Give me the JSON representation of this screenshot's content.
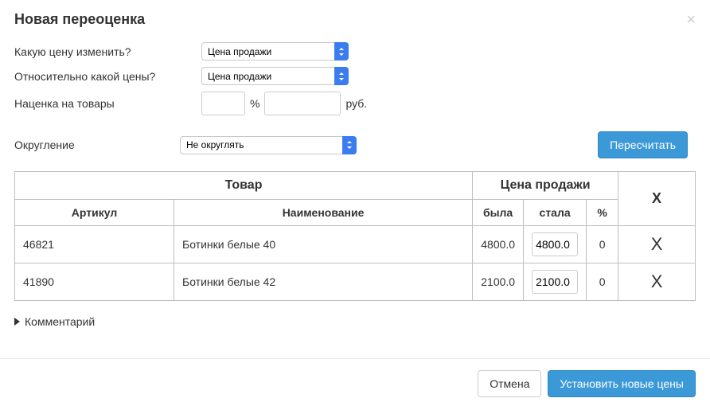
{
  "modal": {
    "title": "Новая переоценка"
  },
  "form": {
    "which_price_label": "Какую цену изменить?",
    "which_price_value": "Цена продажи",
    "relative_to_label": "Относительно какой цены?",
    "relative_to_value": "Цена продажи",
    "markup_label": "Наценка на товары",
    "percent_unit": "%",
    "rub_unit": "руб.",
    "rounding_label": "Округление",
    "rounding_value": "Не округлять",
    "recalc_label": "Пересчитать"
  },
  "table": {
    "product_header": "Товар",
    "price_header": "Цена продажи",
    "x_header": "X",
    "article_header": "Артикул",
    "name_header": "Наименование",
    "was_header": "была",
    "became_header": "стала",
    "percent_header": "%",
    "rows": [
      {
        "article": "46821",
        "name": "Ботинки белые 40",
        "was": "4800.0",
        "became": "4800.0",
        "percent": "0",
        "x": "X"
      },
      {
        "article": "41890",
        "name": "Ботинки белые 42",
        "was": "2100.0",
        "became": "2100.0",
        "percent": "0",
        "x": "X"
      }
    ]
  },
  "comment": {
    "label": "Комментарий"
  },
  "footer": {
    "cancel_label": "Отмена",
    "apply_label": "Установить новые цены"
  }
}
